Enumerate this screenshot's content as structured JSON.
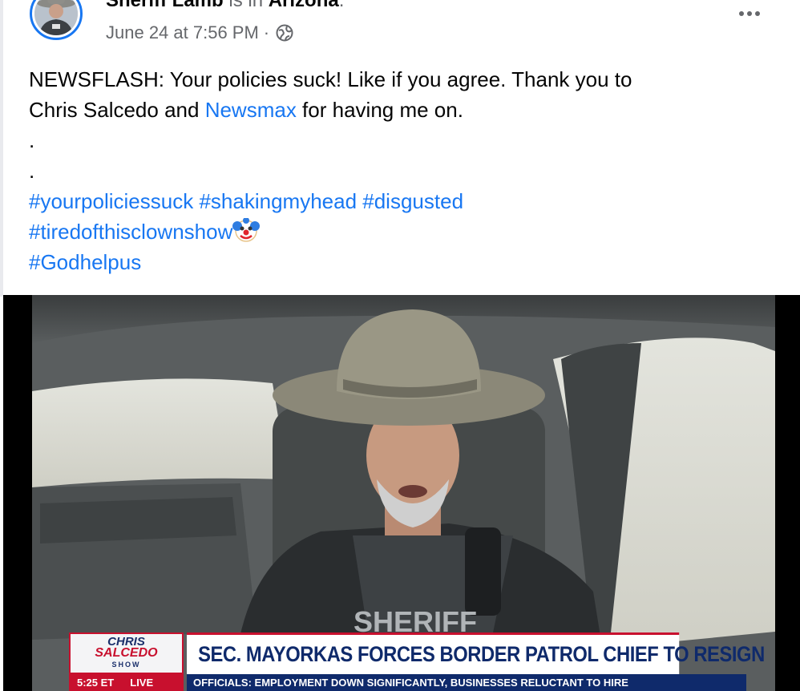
{
  "post": {
    "author": "Sheriff Lamb",
    "status_connector": "is in",
    "location": "Arizona",
    "status_end": ".",
    "timestamp": "June 24 at 7:56 PM",
    "separator": "·",
    "audience_icon": "globe-icon",
    "more_icon": "more-options-icon",
    "text_line1": "NEWSFLASH: Your policies suck! Like if you agree. Thank you to",
    "text_line2_a": "Chris Salcedo and ",
    "text_line2_link": "Newsmax",
    "text_line2_b": " for having me on.",
    "dot_line1": ".",
    "dot_line2": ".",
    "hashtags": {
      "tag1": "#yourpoliciessuck",
      "tag2": "#shakingmyhead",
      "tag3": "#disgusted",
      "tag4": "#tiredofthisclownshow",
      "tag5": "#Godhelpus"
    },
    "emoji": "clown-face-emoji"
  },
  "video": {
    "show_logo_line1": "CHRIS",
    "show_logo_line2": "SALCEDO",
    "show_logo_line3": "SHOW",
    "headline": "SEC. MAYORKAS FORCES BORDER PATROL CHIEF TO RESIGN",
    "time": "5:25 ET",
    "live": "LIVE",
    "ticker": "OFFICIALS: EMPLOYMENT DOWN SIGNIFICANTLY, BUSINESSES RELUCTANT TO HIRE",
    "vest_text": "SHERIFF"
  },
  "colors": {
    "link": "#1877f2",
    "meta_gray": "#65676b",
    "headline_navy": "#0f2a6b",
    "brand_red": "#c8102e"
  }
}
